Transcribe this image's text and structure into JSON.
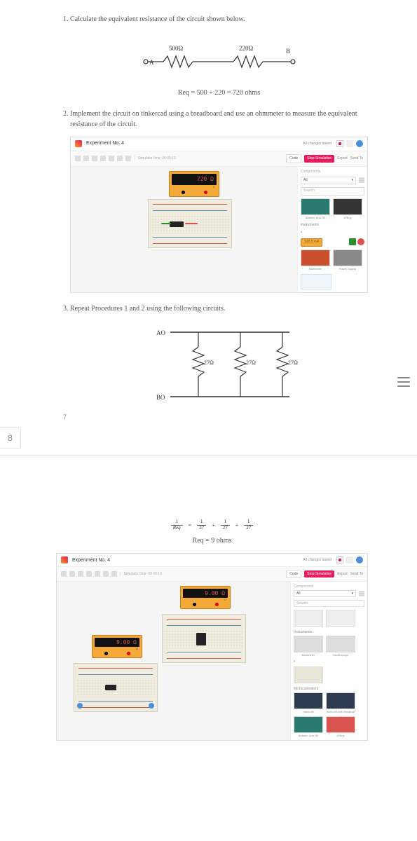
{
  "q1": {
    "prompt": "Calculate the equivalent resistance of the circuit shown below.",
    "node_a": "A",
    "node_b": "B",
    "r1_label": "500Ω",
    "r2_label": "220Ω",
    "calc": "Req = 500 + 220 = 720 ohms"
  },
  "q2": {
    "prompt": "Implement the circuit on tinkercad using a breadboard and use an ohmmeter to measure the equivalent resistance of the circuit."
  },
  "tc1": {
    "title": "Experiment No. 4",
    "changes": "All changes saved",
    "sim_time": "Simulator time: 00:00:10",
    "code": "Code",
    "stop_sim": "Stop Simulation",
    "export": "Export",
    "send_to": "Send To",
    "components_label": "Components",
    "all": "All",
    "search": "Search",
    "instruments": "Instruments",
    "arduino": "Arduino Uno R3",
    "attiny": "ATtiny",
    "multimeter": "Multimeter",
    "power_supply": "Power Supply",
    "multimeter_reading": "720 Ω",
    "ma_reading": "128.8 mA"
  },
  "q3": {
    "prompt": "Repeat Procedures 1 and 2 using the following circuits.",
    "node_a": "AO",
    "node_b": "BO",
    "r_label": "27Ω"
  },
  "page_corner": "7",
  "page_tab": "8",
  "parallel_calc": {
    "lhs_top": "1",
    "lhs_bot": "Req",
    "term_top": "1",
    "term_bot": "27",
    "result": "Req = 9 ohms"
  },
  "tc2": {
    "title": "Experiment No. 4",
    "changes": "All changes saved",
    "sim_time": "Simulator time: 00:00:10",
    "code": "Code",
    "stop_sim": "Stop Simulation",
    "export": "Export",
    "send_to": "Send To",
    "components_label": "Components",
    "all": "All",
    "search": "Search",
    "instruments": "Instruments",
    "micro": "Microcontrollers",
    "multimeter_reading1": "9.00 Ω",
    "multimeter_reading2": "9.00 Ω",
    "microbit": "micro:bit",
    "microbit2": "micro:bit with Breakout",
    "arduino": "Arduino Uno R3",
    "attiny": "ATtiny",
    "multimeter": "Multimeter",
    "oscilloscope": "Oscilloscope"
  }
}
